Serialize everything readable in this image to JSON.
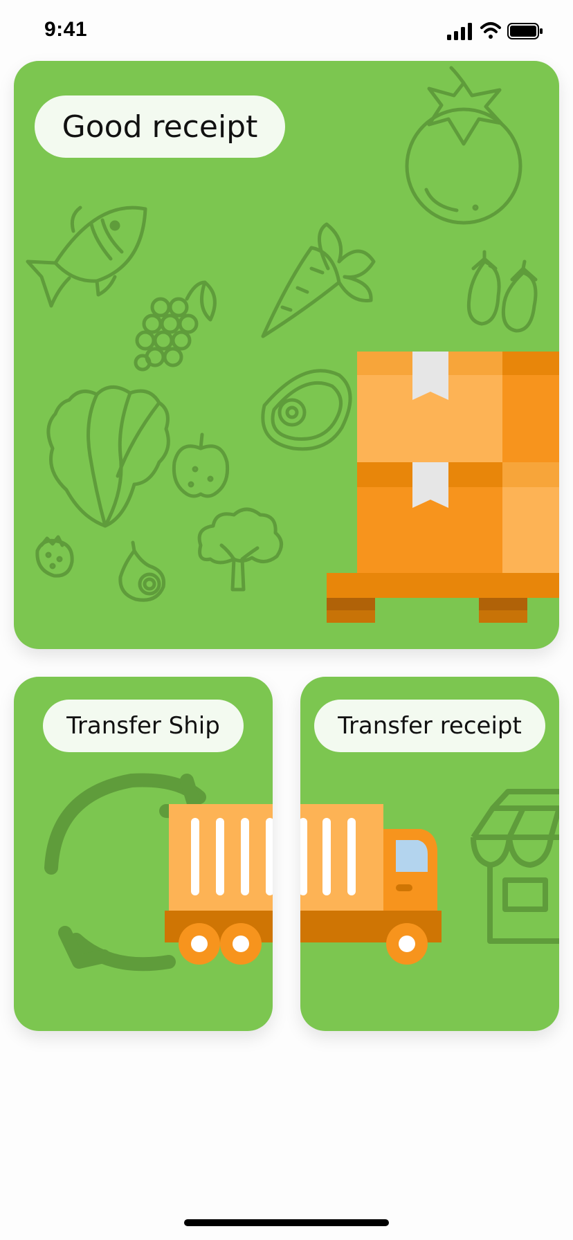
{
  "status_bar": {
    "time": "9:41",
    "icons": [
      "signal-icon",
      "wifi-icon",
      "battery-icon"
    ]
  },
  "cards": {
    "good_receipt": {
      "label": "Good receipt",
      "illustration": "pallet-boxes-with-grocery-icons"
    },
    "transfer_ship": {
      "label": "Transfer Ship",
      "illustration": "truck-with-refresh-arrows"
    },
    "transfer_receipt": {
      "label": "Transfer receipt",
      "illustration": "truck-with-store"
    }
  },
  "colors": {
    "card_green": "#7cc650",
    "line_art_green": "#5f9c3b",
    "orange": "#f7941d",
    "orange_light": "#fdb355",
    "orange_dark": "#e8860a",
    "pill_bg": "#f3faf0"
  }
}
